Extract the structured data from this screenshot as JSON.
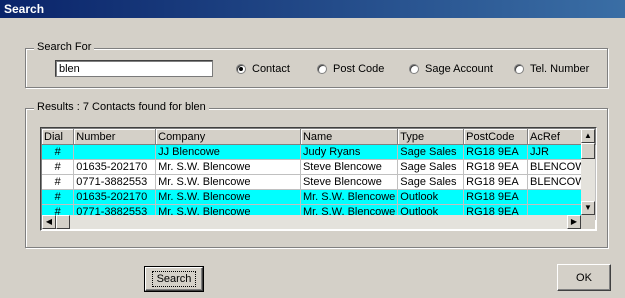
{
  "window": {
    "title": "Search"
  },
  "search_for": {
    "legend": "Search For",
    "query_value": "blen",
    "radios": [
      {
        "label": "Contact",
        "checked": true
      },
      {
        "label": "Post Code",
        "checked": false
      },
      {
        "label": "Sage Account",
        "checked": false
      },
      {
        "label": "Tel. Number",
        "checked": false
      }
    ]
  },
  "results": {
    "legend": "Results : 7 Contacts found for blen",
    "columns": [
      "Dial",
      "Number",
      "Company",
      "Name",
      "Type",
      "PostCode",
      "AcRef"
    ],
    "rows": [
      {
        "highlight": true,
        "cells": [
          "#",
          "",
          "JJ Blencowe",
          "Judy Ryans",
          "Sage Sales",
          "RG18 9EA",
          "JJR"
        ]
      },
      {
        "highlight": false,
        "cells": [
          "#",
          "01635-202170",
          "Mr. S.W. Blencowe",
          "Steve Blencowe",
          "Sage Sales",
          "RG18 9EA",
          "BLENCOWE"
        ]
      },
      {
        "highlight": false,
        "cells": [
          "#",
          "0771-3882553",
          "Mr. S.W. Blencowe",
          "Steve Blencowe",
          "Sage Sales",
          "RG18 9EA",
          "BLENCOWE"
        ]
      },
      {
        "highlight": true,
        "cells": [
          "#",
          "01635-202170",
          "Mr. S.W. Blencowe",
          "Mr. S.W. Blencowe",
          "Outlook",
          "RG18 9EA",
          ""
        ]
      },
      {
        "highlight": true,
        "cells": [
          "#",
          "0771-3882553",
          "Mr. S.W. Blencowe",
          "Mr. S.W. Blencowe",
          "Outlook",
          "RG18 9EA",
          ""
        ]
      }
    ]
  },
  "buttons": {
    "search": "Search",
    "ok": "OK"
  },
  "colors": {
    "highlight_row": "#00ffff",
    "titlebar": "#0a246a",
    "face": "#d4d0c8"
  },
  "icons": [
    "radio-button-icon",
    "scroll-up-arrow-icon",
    "scroll-down-arrow-icon",
    "scroll-left-arrow-icon",
    "scroll-right-arrow-icon"
  ]
}
